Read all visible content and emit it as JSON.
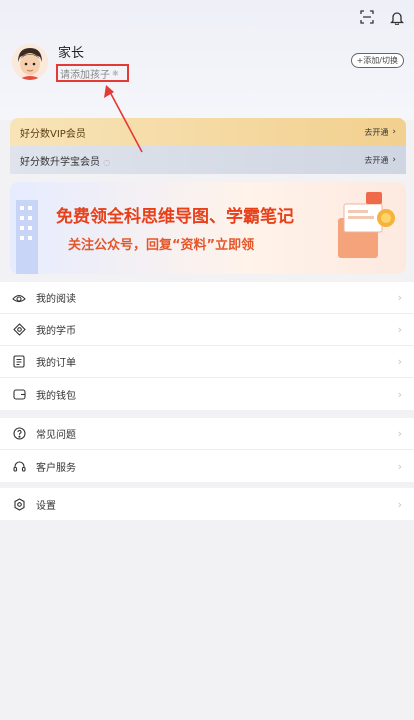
{
  "profile": {
    "name": "家长",
    "add_child_text": "请添加孩子",
    "switch_label": "+添加/切换"
  },
  "cards": {
    "vip": {
      "title": "好分数VIP会员",
      "action": "去开通"
    },
    "xb": {
      "title": "好分数升学宝会员",
      "action": "去开通"
    }
  },
  "banner": {
    "title": "免费领全科思维导图、学霸笔记",
    "subtitle": "关注公众号，回复“资料”立即领"
  },
  "menu": {
    "group1": [
      {
        "label": "我的阅读",
        "icon": "eye-icon"
      },
      {
        "label": "我的学币",
        "icon": "coin-icon"
      },
      {
        "label": "我的订单",
        "icon": "order-icon"
      },
      {
        "label": "我的钱包",
        "icon": "wallet-icon"
      }
    ],
    "group2": [
      {
        "label": "常见问题",
        "icon": "question-icon"
      },
      {
        "label": "客户服务",
        "icon": "headset-icon"
      }
    ],
    "group3": [
      {
        "label": "设置",
        "icon": "settings-icon"
      }
    ]
  },
  "colors": {
    "highlight_box": "#e53935",
    "vip_gold": "#f2d08f",
    "banner_red": "#e8401a"
  }
}
